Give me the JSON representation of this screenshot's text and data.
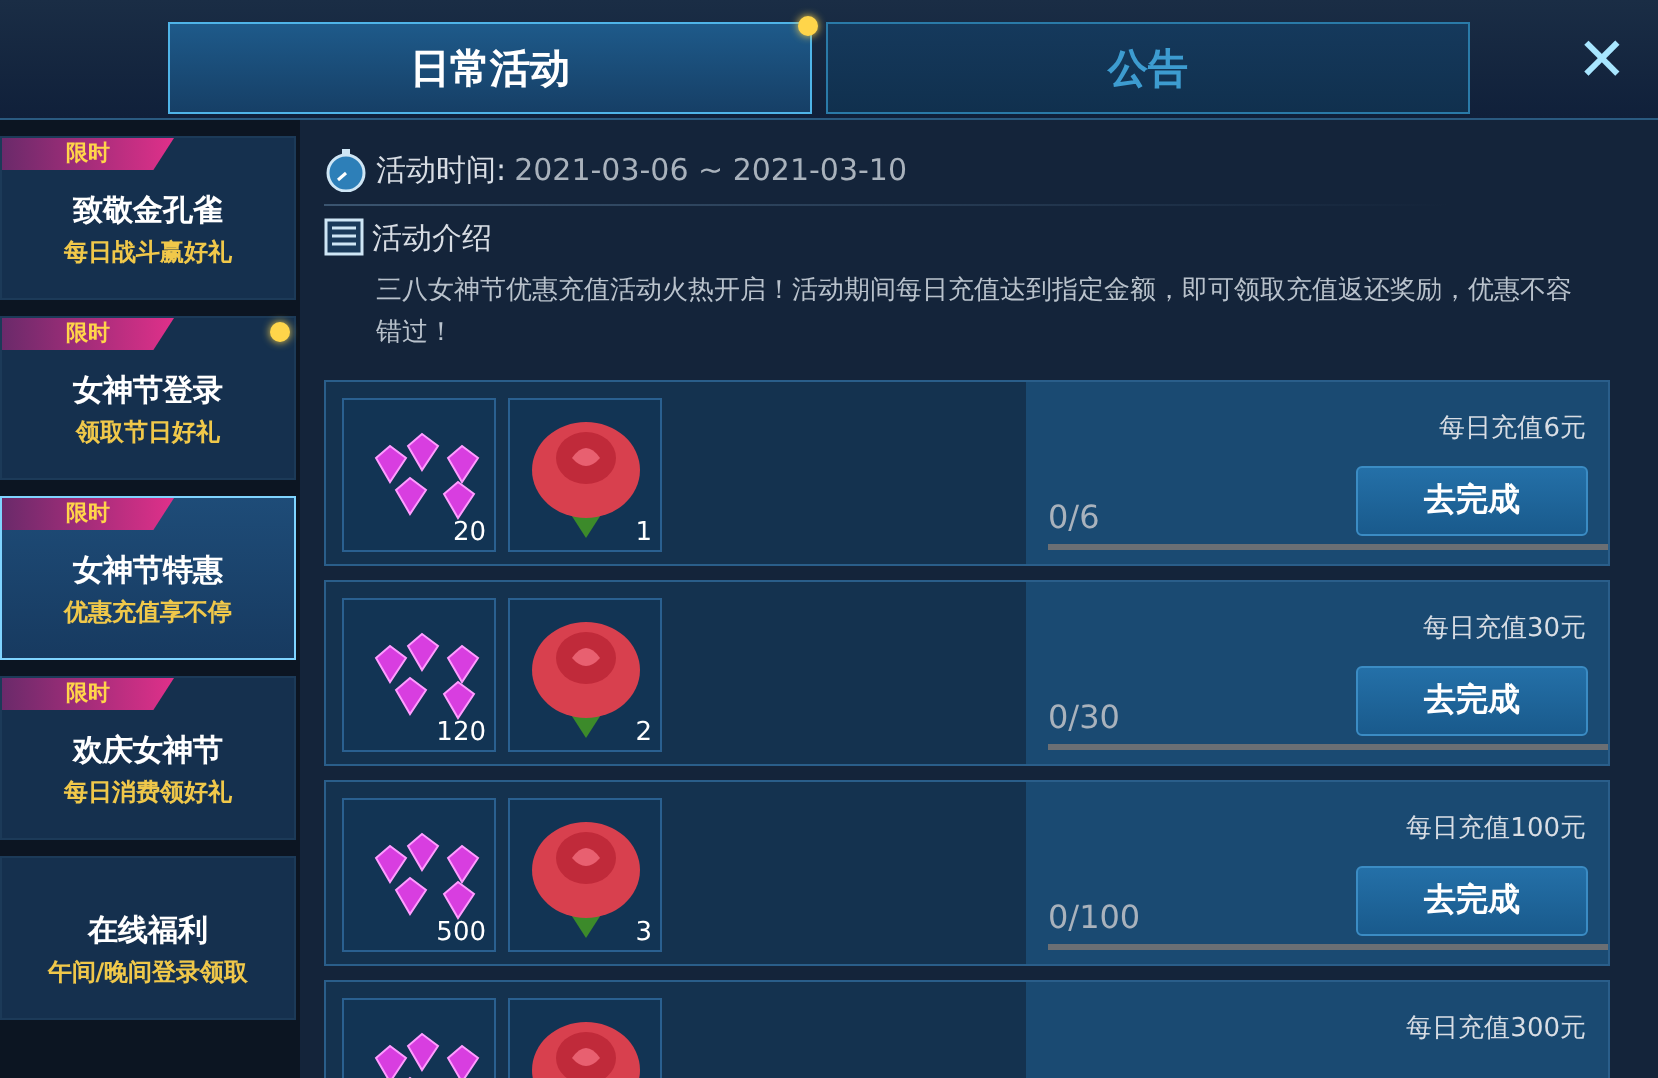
{
  "tabs": [
    {
      "label": "日常活动",
      "selected": true,
      "badge": true
    },
    {
      "label": "公告",
      "selected": false,
      "badge": false
    }
  ],
  "close": {
    "label": "✕"
  },
  "sidebar": {
    "items": [
      {
        "title": "致敬金孔雀",
        "subtitle": "每日战斗赢好礼",
        "tag": "限时",
        "selected": false,
        "badge": false
      },
      {
        "title": "女神节登录",
        "subtitle": "领取节日好礼",
        "tag": "限时",
        "selected": false,
        "badge": true
      },
      {
        "title": "女神节特惠",
        "subtitle": "优惠充值享不停",
        "tag": "限时",
        "selected": true,
        "badge": false
      },
      {
        "title": "欢庆女神节",
        "subtitle": "每日消费领好礼",
        "tag": "限时",
        "selected": false,
        "badge": false
      },
      {
        "title": "在线福利",
        "subtitle": "午间/晚间登录领取",
        "selected": false,
        "badge": false
      }
    ]
  },
  "activity": {
    "time_label": "活动时间:",
    "time_value": "2021-03-06 ~ 2021-03-10",
    "intro_title": "活动介绍",
    "intro_text": "三八女神节优惠充值活动火热开启！活动期间每日充值达到指定金额，即可领取充值返还奖励，优惠不容错过！"
  },
  "tasks": [
    {
      "goal": "每日充值6元",
      "progress": "0/6",
      "level": 0,
      "button": "去完成",
      "rewards": [
        {
          "kind": "gem",
          "count": "20"
        },
        {
          "kind": "rose",
          "count": "1"
        }
      ]
    },
    {
      "goal": "每日充值30元",
      "progress": "0/30",
      "level": 0,
      "button": "去完成",
      "rewards": [
        {
          "kind": "gem",
          "count": "120"
        },
        {
          "kind": "rose",
          "count": "2"
        }
      ]
    },
    {
      "goal": "每日充值100元",
      "progress": "0/100",
      "level": 0,
      "button": "去完成",
      "rewards": [
        {
          "kind": "gem",
          "count": "500"
        },
        {
          "kind": "rose",
          "count": "3"
        }
      ]
    },
    {
      "goal": "每日充值300元",
      "rewards": [
        {
          "kind": "gem"
        },
        {
          "kind": "rose"
        }
      ]
    }
  ]
}
